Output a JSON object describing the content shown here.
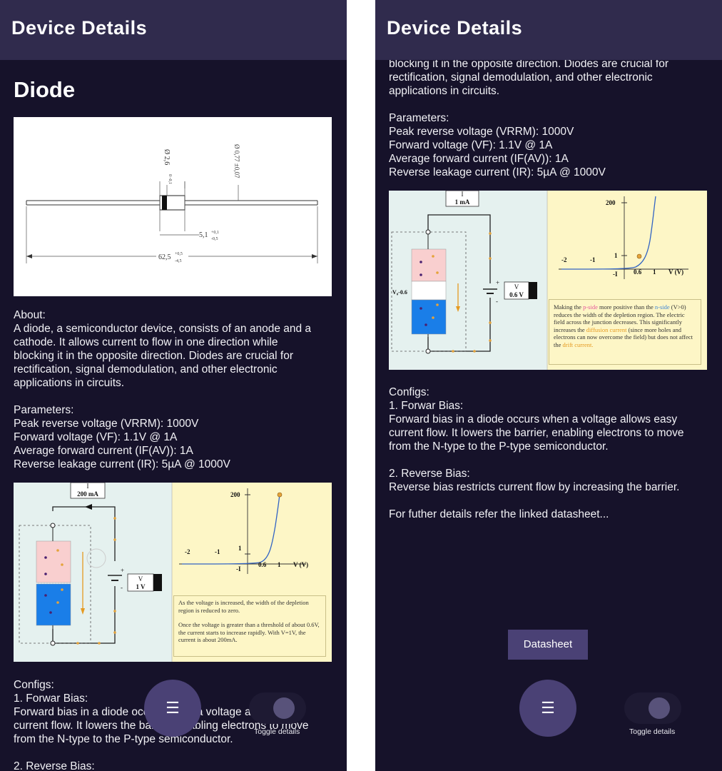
{
  "app": {
    "title": "Device Details"
  },
  "device": {
    "name": "Diode"
  },
  "dimension_drawing": {
    "dim_top1": "Ø 2,6",
    "dim_top1_tol": "0 -0,1",
    "dim_top2": "Ø 0,77 ±0,07",
    "dim_mid": "5,1",
    "dim_mid_tol_plus": "+0,1",
    "dim_mid_tol_minus": "-0,5",
    "dim_total": "62,5",
    "dim_total_tol_plus": "+0,5",
    "dim_total_tol_minus": "-4,5"
  },
  "about": {
    "heading": "About:",
    "line1": "A diode, a semiconductor device, consists of an anode and a",
    "line2": "cathode. It allows current to flow in one direction while",
    "line3": "blocking it in the opposite direction. Diodes are crucial for",
    "line4": "rectification, signal demodulation, and other electronic",
    "line5": "applications in circuits."
  },
  "parameters": {
    "heading": "Parameters:",
    "p1": "Peak reverse voltage (VRRM): 1000V",
    "p2": "Forward voltage (VF): 1.1V @ 1A",
    "p3": "Average forward current (IF(AV)): 1A",
    "p4": "Reverse leakage current (IR): 5µA @ 1000V"
  },
  "diagram_left": {
    "meter_label": "I",
    "meter_value": "200 mA",
    "source_label": "V",
    "source_value": "1 V",
    "y_top": "200",
    "y_one": "1",
    "x_m2": "-2",
    "x_m1": "-1",
    "x_i0": "-I",
    "x_06": "0.6",
    "x_1": "1",
    "x_axis": "V (V)",
    "note_p1": "As the voltage is increased, the width of the depletion region is reduced to zero.",
    "note_p2": "Once the voltage is greater than a threshold of about 0.6V, the current starts to increase rapidly. With V=1V, the current is about 200mA."
  },
  "diagram_right": {
    "meter_label": "I",
    "meter_value": "1 mA",
    "source_label": "V",
    "source_value": "0.6 V",
    "side_label": "V₀-0.6",
    "y_top": "200",
    "y_one": "1",
    "x_m2": "-2",
    "x_m1": "-1",
    "x_i0": "-I",
    "x_06": "0.6",
    "x_1": "1",
    "x_axis": "V (V)",
    "note_a": "Making the",
    "note_b": "p-side",
    "note_c": "more positive than the",
    "note_d": "n-side",
    "note_e": "(V>0) reduces the width of the depletion region. The electric field across the junction decreases. This significantly increases the",
    "note_f": "diffusion current",
    "note_g": "(since more holes and electrons can now overcome the field) but does not affect the",
    "note_h": "drift current."
  },
  "configs": {
    "heading": "Configs:",
    "c1_title": "1. Forwar Bias:",
    "c1_line1": "Forward bias in a diode occurs when a voltage allows easy",
    "c1_line2": "current flow. It lowers the barrier, enabling electrons to move",
    "c1_line3": "from the N-type to the P-type semiconductor.",
    "c2_title": "2. Reverse Bias:",
    "c2_text": "Reverse bias restricts current flow by increasing the barrier.",
    "footer": "For futher details refer the linked datasheet..."
  },
  "right_scroll": {
    "clip_line": "blocking it in the opposite direction. Diodes are crucial for"
  },
  "controls": {
    "menu_icon": "menu-icon",
    "menu_glyph": "☰",
    "toggle_label": "Toggle details",
    "datasheet_label": "Datasheet"
  },
  "colors": {
    "background": "#16122a",
    "appbar": "#302b4d",
    "fab": "#4a4175",
    "p_type": "#f9cfcf",
    "n_type": "#1a7ee8"
  }
}
